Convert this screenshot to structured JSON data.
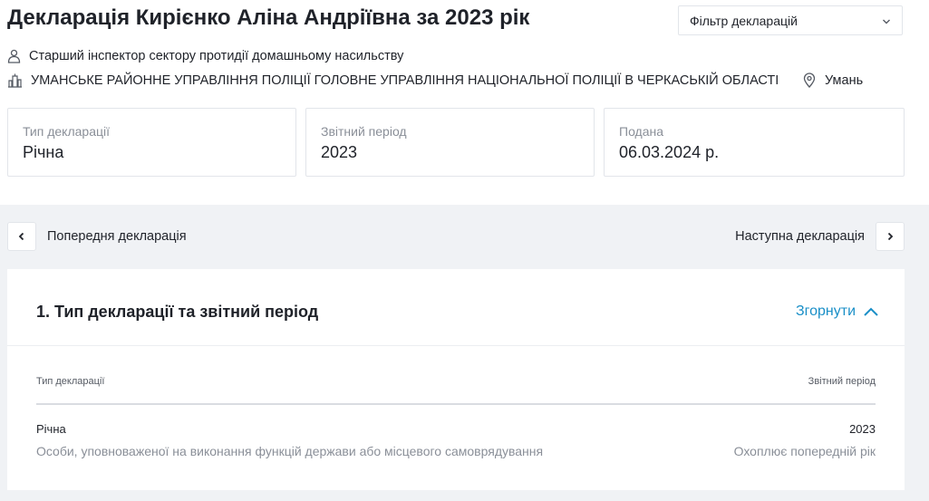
{
  "header": {
    "title": "Декларація Кирієнко Аліна Андріївна за 2023 рік",
    "filter_label": "Фільтр декларацій",
    "position": "Старший інспектор сектору протидії домашньому насильству",
    "organization": "УМАНСЬКЕ РАЙОННЕ УПРАВЛІННЯ ПОЛІЦІЇ ГОЛОВНЕ УПРАВЛІННЯ НАЦІОНАЛЬНОЇ ПОЛІЦІЇ В ЧЕРКАСЬКІЙ ОБЛАСТІ",
    "location": "Умань"
  },
  "cards": [
    {
      "caption": "Тип декларації",
      "value": "Річна"
    },
    {
      "caption": "Звітний період",
      "value": "2023"
    },
    {
      "caption": "Подана",
      "value": "06.03.2024 р."
    }
  ],
  "nav": {
    "prev_label": "Попередня декларація",
    "next_label": "Наступна декларація"
  },
  "section": {
    "title": "1. Тип декларації та звітний період",
    "collapse_label": "Згорнути",
    "col_left_header": "Тип декларації",
    "col_right_header": "Звітний період",
    "left_value": "Річна",
    "left_sub": "Особи, уповноваженої на виконання функцій держави або місцевого самоврядування",
    "right_value": "2023",
    "right_sub": "Охоплює попередній рік"
  },
  "colors": {
    "accent": "#1a8fc7",
    "background_gray": "#f0f2f5",
    "border": "#e2e5ea"
  },
  "icons": [
    "person-icon",
    "building-icon",
    "location-pin-icon",
    "chevron-down-icon",
    "chevron-left-icon",
    "chevron-right-icon",
    "chevron-up-icon"
  ]
}
